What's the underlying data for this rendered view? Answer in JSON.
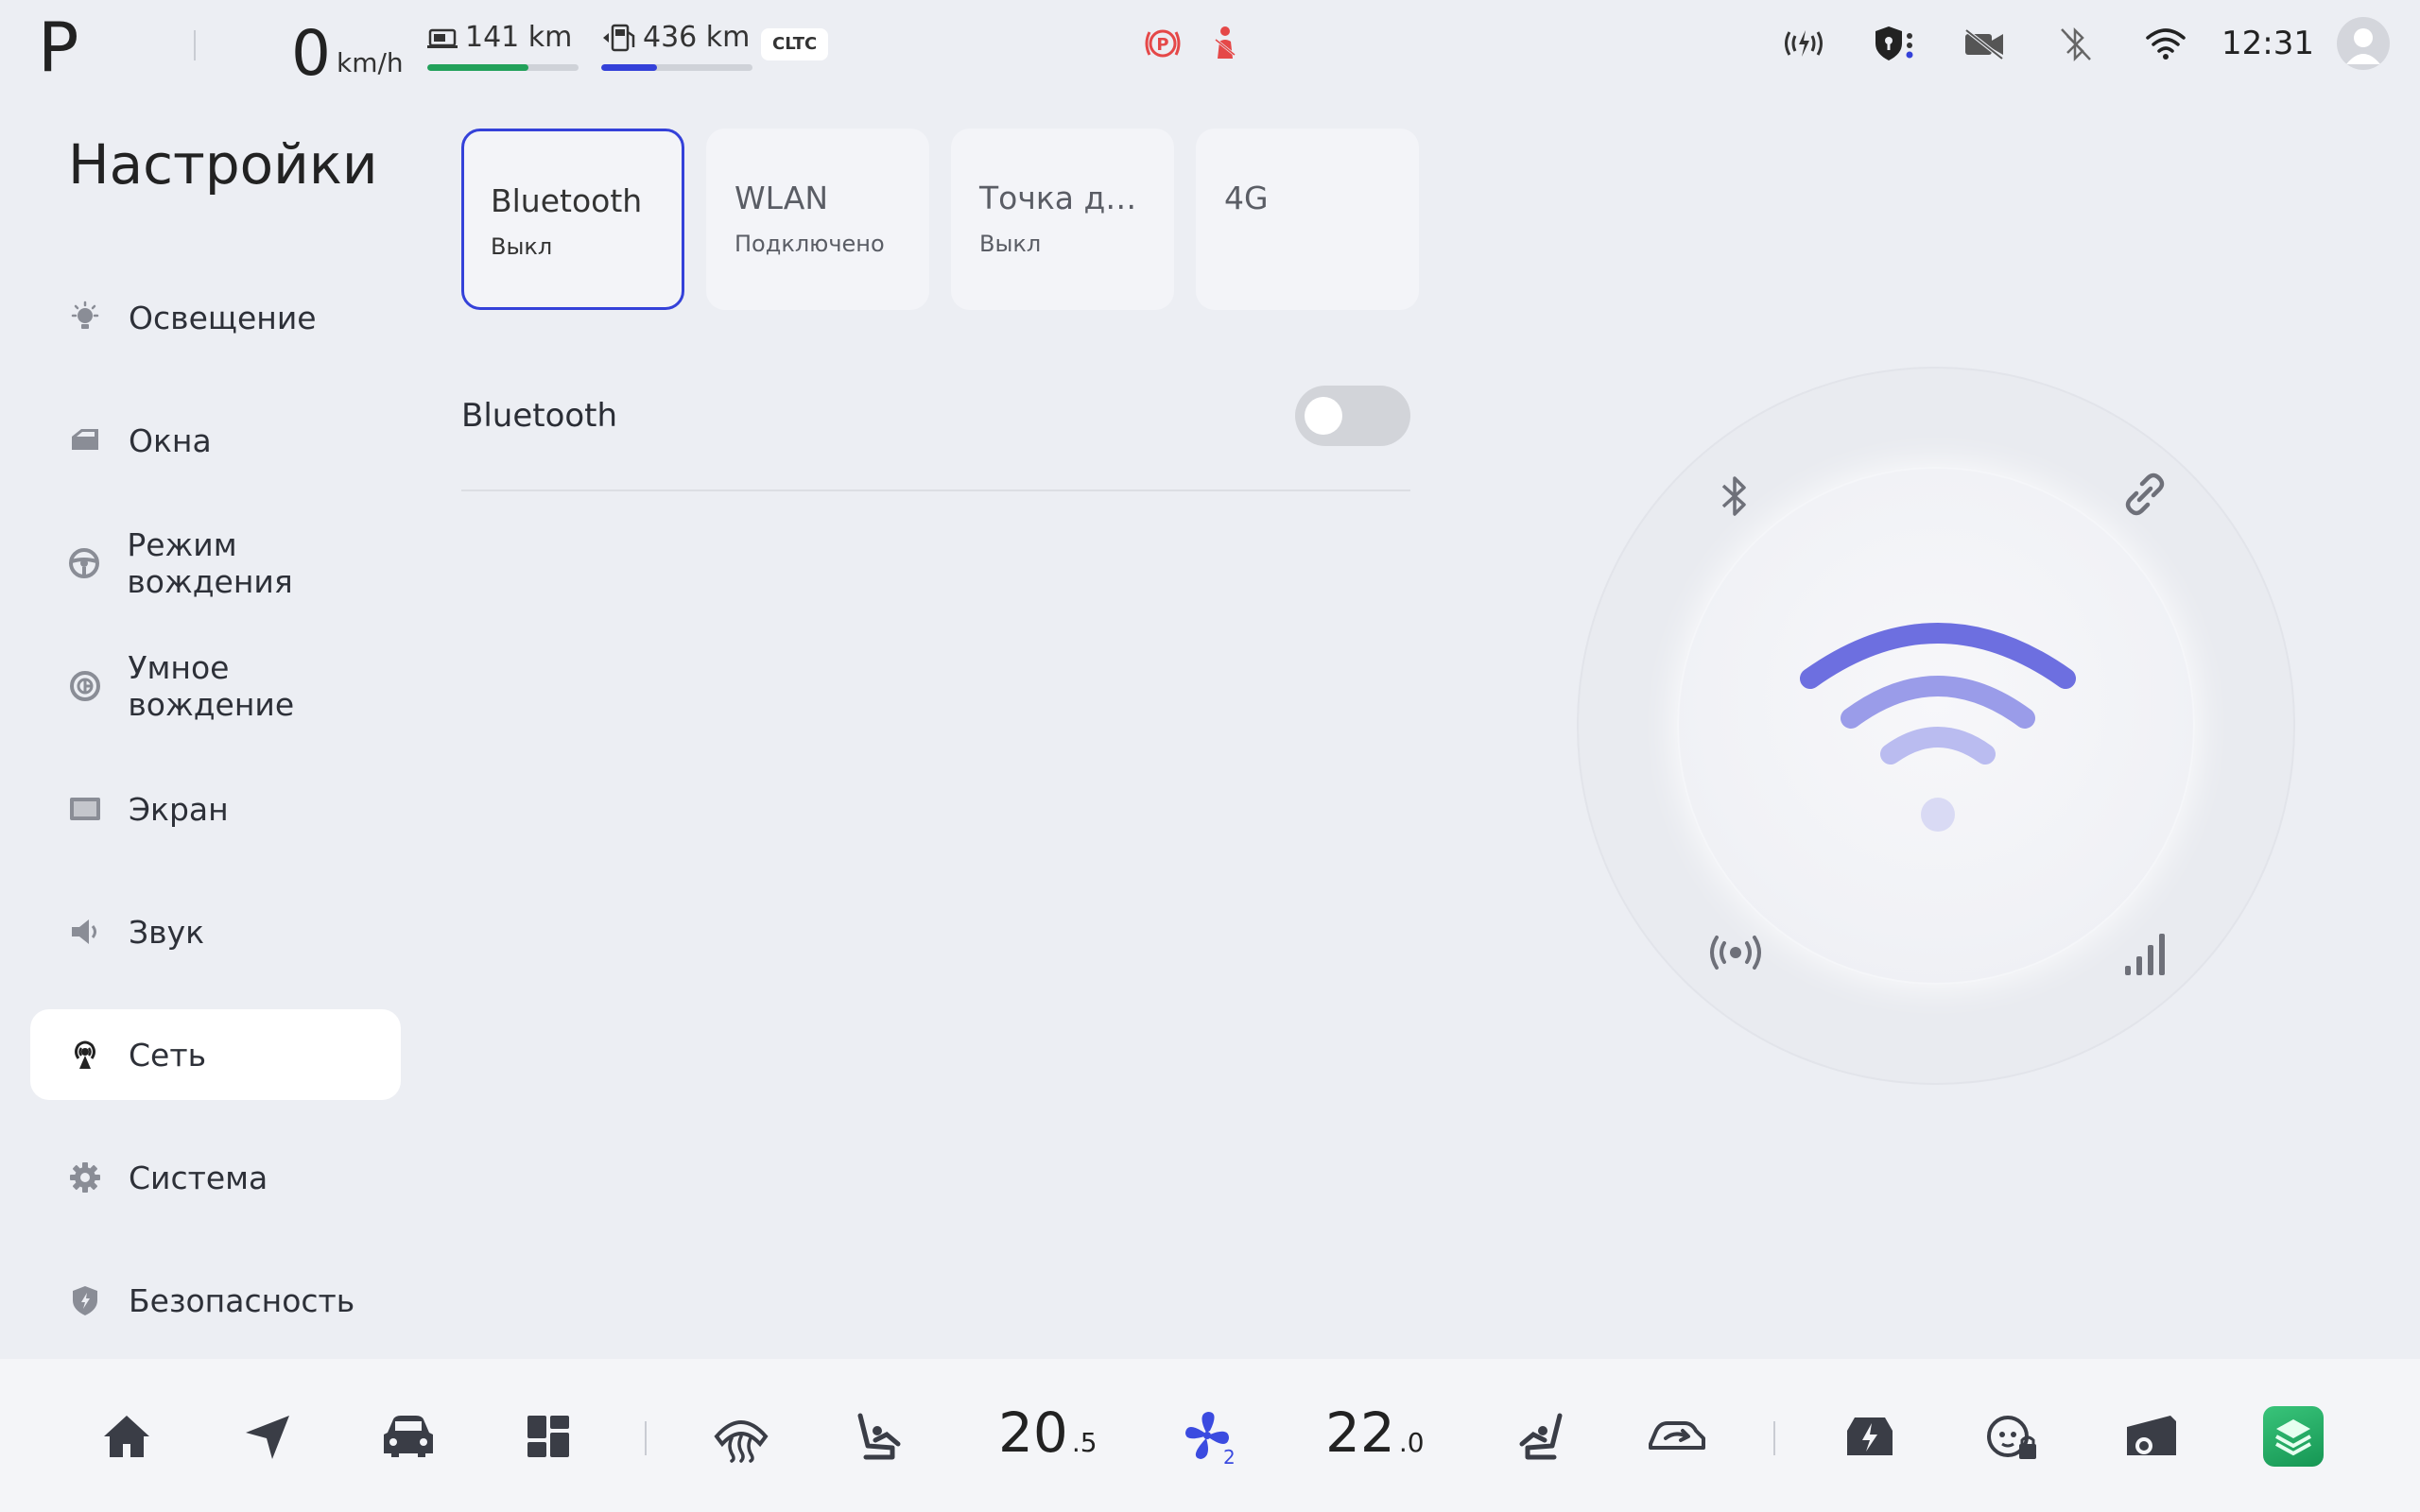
{
  "status_bar": {
    "gear": "P",
    "speed_value": "0",
    "speed_unit": "km/h",
    "range_battery": "141 km",
    "range_battery_fill": 0.67,
    "range_fuel": "436 km",
    "range_fuel_fill": 0.37,
    "range_standard": "CLTC",
    "time": "12:31",
    "warning_color": "#e54848"
  },
  "settings": {
    "title": "Настройки",
    "nav": [
      {
        "label": "Освещение",
        "icon": "light-bulb-icon"
      },
      {
        "label": "Окна",
        "icon": "window-icon"
      },
      {
        "label": "Режим вождения",
        "icon": "steering-wheel-icon"
      },
      {
        "label": "Умное вождение",
        "icon": "smart-driving-icon"
      },
      {
        "label": "Экран",
        "icon": "screen-icon"
      },
      {
        "label": "Звук",
        "icon": "speaker-icon"
      },
      {
        "label": "Сеть",
        "icon": "network-icon",
        "active": true
      },
      {
        "label": "Система",
        "icon": "gear-icon"
      },
      {
        "label": "Безопасность",
        "icon": "shield-icon"
      }
    ]
  },
  "network": {
    "tabs": [
      {
        "title": "Bluetooth",
        "status": "Выкл",
        "active": true
      },
      {
        "title": "WLAN",
        "status": "Подключено"
      },
      {
        "title": "Точка д…",
        "status": "Выкл"
      },
      {
        "title": "4G",
        "status": ""
      }
    ],
    "bluetooth_label": "Bluetooth",
    "bluetooth_on": false,
    "accent_color": "#6d6fe0"
  },
  "climate": {
    "driver_temp": "20",
    "driver_temp_decimal": ".5",
    "fan_level": "2",
    "passenger_temp": "22",
    "passenger_temp_decimal": ".0",
    "fan_color": "#3b4be0"
  }
}
